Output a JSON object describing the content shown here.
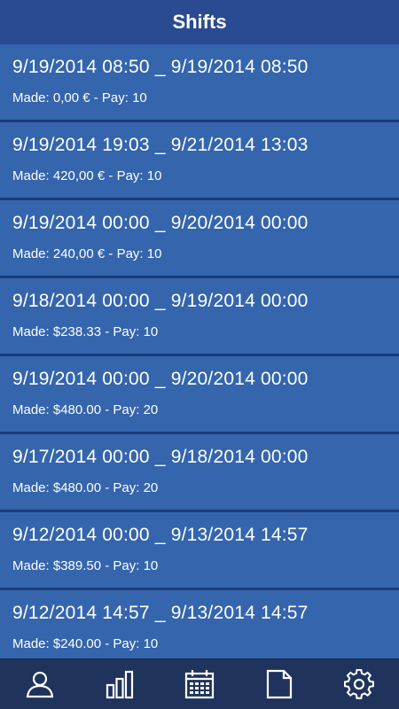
{
  "header": {
    "title": "Shifts"
  },
  "shifts": [
    {
      "range": "9/19/2014 08:50 _ 9/19/2014 08:50",
      "made": "Made: 0,00 € - Pay: 10"
    },
    {
      "range": "9/19/2014 19:03 _ 9/21/2014 13:03",
      "made": "Made: 420,00 € - Pay: 10"
    },
    {
      "range": "9/19/2014 00:00 _ 9/20/2014 00:00",
      "made": "Made: 240,00 € - Pay: 10"
    },
    {
      "range": "9/18/2014 00:00 _ 9/19/2014 00:00",
      "made": "Made: $238.33 - Pay: 10"
    },
    {
      "range": "9/19/2014 00:00 _ 9/20/2014 00:00",
      "made": "Made: $480.00 - Pay: 20"
    },
    {
      "range": "9/17/2014 00:00 _ 9/18/2014 00:00",
      "made": "Made: $480.00 - Pay: 20"
    },
    {
      "range": "9/12/2014 00:00 _ 9/13/2014 14:57",
      "made": "Made: $389.50 - Pay: 10"
    },
    {
      "range": "9/12/2014 14:57 _ 9/13/2014 14:57",
      "made": "Made: $240.00 - Pay: 10"
    }
  ],
  "tabbar": {
    "tabs": [
      {
        "icon": "person-icon"
      },
      {
        "icon": "bar-chart-icon"
      },
      {
        "icon": "calendar-icon"
      },
      {
        "icon": "document-icon"
      },
      {
        "icon": "gear-icon"
      }
    ]
  },
  "colors": {
    "header_bg": "#2a4a92",
    "row_bg": "#3465ad",
    "tabbar_bg": "#20335c",
    "text": "#ffffff"
  }
}
